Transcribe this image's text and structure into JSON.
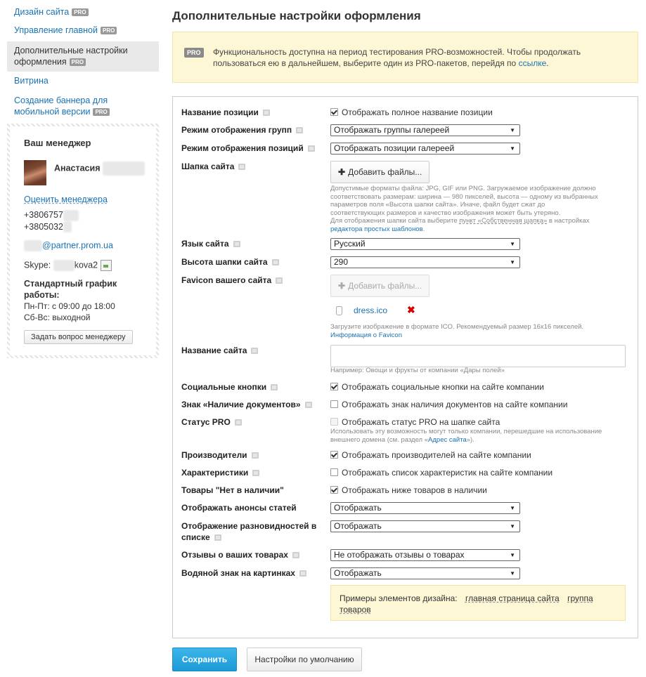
{
  "sidebar": {
    "items": [
      {
        "label": "Дизайн сайта",
        "pro": "PRO"
      },
      {
        "label": "Управление главной",
        "pro": "PRO"
      },
      {
        "label": "Дополнительные настройки оформления",
        "pro": "PRO"
      },
      {
        "label": "Витрина",
        "pro": ""
      },
      {
        "label": "Создание баннера для мобильной версии",
        "pro": "PRO"
      }
    ]
  },
  "manager": {
    "title": "Ваш менеджер",
    "name": "Анастасия",
    "rate_link": "Оценить менеджера",
    "phone1": "+3806757",
    "phone2": "+3805032",
    "email_suffix": "@partner.prom.ua",
    "skype_label": "Skype:",
    "skype_suffix": "kova2",
    "schedule_title": "Стандартный график работы:",
    "schedule_weekdays": "Пн-Пт: с 09:00 до 18:00",
    "schedule_weekend": "Сб-Вс: выходной",
    "ask_button": "Задать вопрос менеджеру"
  },
  "page": {
    "title": "Дополнительные настройки оформления",
    "notice_badge": "PRO",
    "notice_text": "Функциональность доступна на период тестирования PRO-возможностей. Чтобы продолжать пользоваться ею в дальнейшем, выберите один из PRO-пакетов, перейдя по ",
    "notice_link": "ссылке",
    "notice_end": "."
  },
  "form": {
    "position_name": {
      "label": "Название позиции",
      "checkbox": "Отображать полное название позиции"
    },
    "groups_mode": {
      "label": "Режим отображения групп",
      "value": "Отображать группы галереей"
    },
    "positions_mode": {
      "label": "Режим отображения позиций",
      "value": "Отображать позиции галереей"
    },
    "header": {
      "label": "Шапка сайта",
      "button": "Добавить файлы...",
      "hint_lines": [
        "Допустимые форматы файла: JPG, GIF или PNG. Загружаемое изображение должно",
        "соответствовать размерам: ширина — 980 пикселей, высота — одному из выбранных",
        "параметров поля «Высота шапки сайта». Иначе, файл будет сжат до",
        "соответствующих размеров и качество изображения может быть утеряно."
      ],
      "hint_pre": "Для отображения шапки сайта выберите ",
      "hint_item": "пункт «Собственная шапка»",
      "hint_mid": " в настройках",
      "hint_link": "редактора простых шаблонов",
      "hint_end": "."
    },
    "language": {
      "label": "Язык сайта",
      "value": "Русский"
    },
    "header_height": {
      "label": "Высота шапки сайта",
      "value": "290"
    },
    "favicon": {
      "label": "Favicon вашего сайта",
      "button": "Добавить файлы...",
      "file": "dress.ico",
      "hint": "Загрузите изображение в формате ICO. Рекомендуемый размер 16x16 пикселей.",
      "hint_link": "Информация о Favicon"
    },
    "site_name": {
      "label": "Название сайта",
      "value": "",
      "hint": "Например: Овощи и фрукты от компании «Дары полей»"
    },
    "social": {
      "label": "Социальные кнопки",
      "checkbox": "Отображать социальные кнопки на сайте компании"
    },
    "documents": {
      "label": "Знак «Наличие документов»",
      "checkbox": "Отображать знак наличия документов на сайте компании"
    },
    "pro_status": {
      "label": "Статус PRO",
      "checkbox": "Отображать статус PRO на шапке сайта",
      "hint_line1": "Использовать эту возможность могут только компании, перешедшие на использование",
      "hint_pre": "внешнего домена (см. раздел «",
      "hint_link": "Адрес сайта",
      "hint_end": "»)."
    },
    "manufacturers": {
      "label": "Производители",
      "checkbox": "Отображать производителей на сайте компании"
    },
    "characteristics": {
      "label": "Характеристики",
      "checkbox": "Отображать список характеристик на сайте компании"
    },
    "out_of_stock": {
      "label": "Товары \"Нет в наличии\"",
      "checkbox": "Отображать ниже товаров в наличии"
    },
    "articles": {
      "label": "Отображать анонсы статей",
      "value": "Отображать"
    },
    "variants": {
      "label_line1": "Отображение разновидностей в",
      "label_line2": "списке",
      "value": "Отображать"
    },
    "reviews": {
      "label": "Отзывы о ваших товарах",
      "value": "Не отображать отзывы о товарах"
    },
    "watermark": {
      "label": "Водяной знак на картинках",
      "value": "Отображать"
    },
    "examples": {
      "label": "Примеры элементов дизайна:",
      "link1": "главная страница сайта",
      "link2": "группа",
      "link3": "товаров"
    }
  },
  "actions": {
    "save": "Сохранить",
    "reset": "Настройки по умолчанию"
  }
}
